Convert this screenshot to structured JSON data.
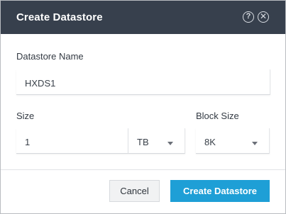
{
  "dialog": {
    "title": "Create Datastore",
    "help_icon": "help-circle-icon",
    "close_icon": "close-circle-icon"
  },
  "form": {
    "datastore_name": {
      "label": "Datastore Name",
      "value": "HXDS1"
    },
    "size": {
      "label": "Size",
      "value": "1",
      "unit": "TB"
    },
    "block_size": {
      "label": "Block Size",
      "value": "8K"
    }
  },
  "buttons": {
    "cancel": "Cancel",
    "create": "Create Datastore"
  },
  "colors": {
    "titlebar": "#37404d",
    "primary": "#1e9fd6"
  }
}
